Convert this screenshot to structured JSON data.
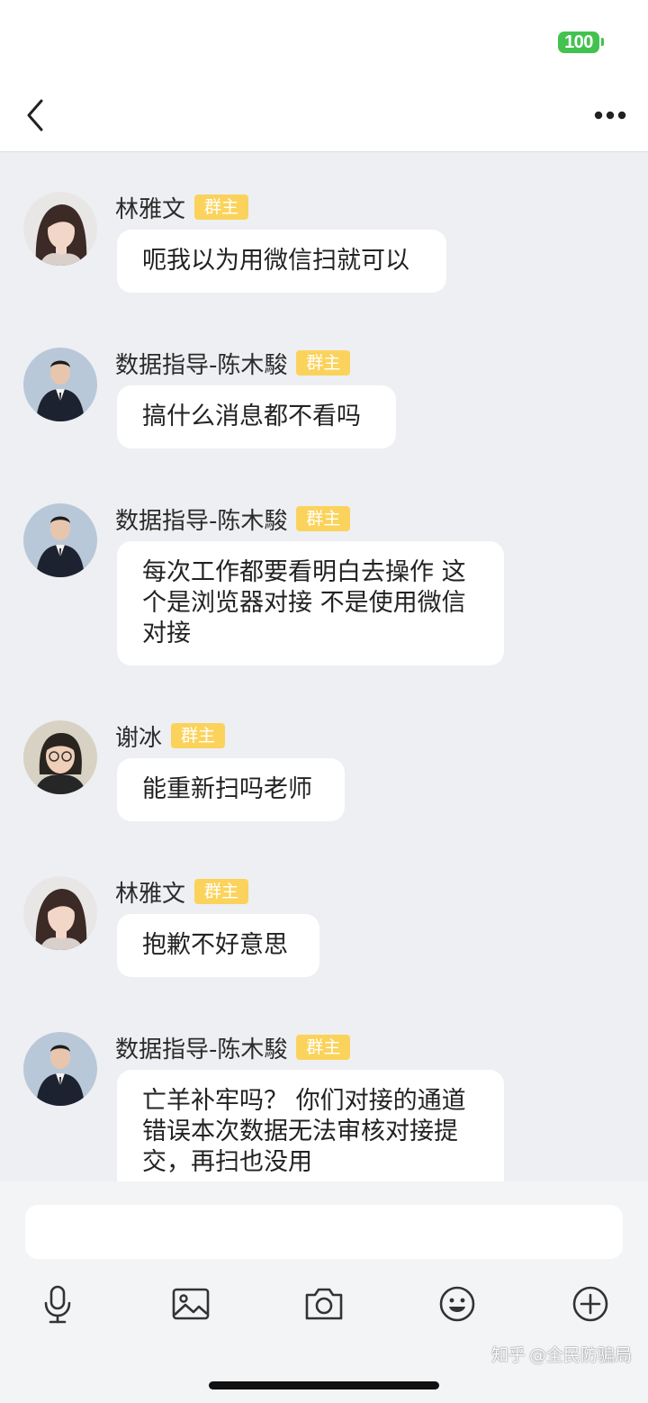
{
  "status_bar": {
    "battery": "100"
  },
  "nav": {
    "back_icon": "chevron-left-icon",
    "more_icon": "more-dots-icon"
  },
  "colors": {
    "badge": "#fbd35c",
    "background": "#edeff2",
    "battery": "#43c24f"
  },
  "messages": [
    {
      "sender": "林雅文",
      "role": "群主",
      "avatar": "woman-avatar",
      "text": "呃我以为用微信扫就可以"
    },
    {
      "sender": "数据指导-陈木駿",
      "role": "群主",
      "avatar": "man-suit-avatar",
      "text": "搞什么消息都不看吗"
    },
    {
      "sender": "数据指导-陈木駿",
      "role": "群主",
      "avatar": "man-suit-avatar",
      "text": "每次工作都要看明白去操作 这个是浏览器对接 不是使用微信对接"
    },
    {
      "sender": "谢冰",
      "role": "群主",
      "avatar": "woman-glasses-avatar",
      "text": "能重新扫吗老师"
    },
    {
      "sender": "林雅文",
      "role": "群主",
      "avatar": "woman-avatar",
      "text": "抱歉不好意思"
    },
    {
      "sender": "数据指导-陈木駿",
      "role": "群主",
      "avatar": "man-suit-avatar",
      "text": "亡羊补牢吗？ 你们对接的通道错误本次数据无法审核对接提交，再扫也没用"
    }
  ],
  "input": {
    "placeholder": ""
  },
  "toolbar": [
    "microphone-icon",
    "image-icon",
    "camera-icon",
    "emoji-icon",
    "plus-circle-icon"
  ],
  "watermark": {
    "site": "知乎",
    "author": "@全民防骗局"
  }
}
